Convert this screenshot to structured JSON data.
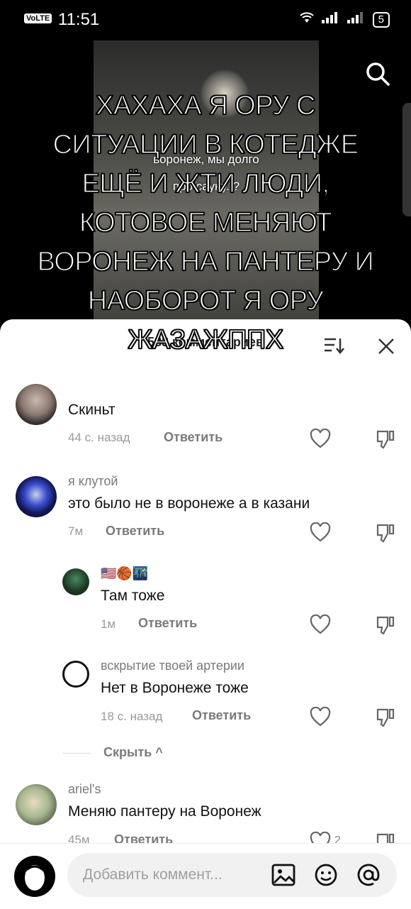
{
  "status_bar": {
    "network": "VoLTE",
    "time": "11:51",
    "battery": "5"
  },
  "video": {
    "caption": "воронеж, мы долго\n...\nпро сауну..?"
  },
  "overlay_text": "ХАХАХА Я ОРУ С СИТУАЦИИ В КОТЕДЖЕ ЕЩЁ И ЖТИ ЛЮДИ, КОТОВОЕ МЕНЯЮТ ВОРОНЕЖ НА ПАНТЕРУ И НАОБОРОТ Я ОРУ ЖАЗАЖППХ",
  "comments_header": {
    "count_label": "583 комментариев"
  },
  "comments": [
    {
      "username": "",
      "text": "Скиньт",
      "time": "44 с. назад",
      "reply_label": "Ответить"
    },
    {
      "username": "я клутой",
      "text": "это было не в воронеже а в казани",
      "time": "7м",
      "reply_label": "Ответить"
    },
    {
      "username": "🇺🇸🏀🌃",
      "text": "Там тоже",
      "time": "1м",
      "reply_label": "Ответить"
    },
    {
      "username": "вскрытие твоей артерии",
      "text": "Нет в Воронеже тоже",
      "time": "18 с. назад",
      "reply_label": "Ответить"
    },
    {
      "username": "ariel's",
      "text": "Меняю пантеру на Воронеж",
      "time": "45м",
      "reply_label": "Ответить",
      "likes": "2"
    }
  ],
  "hide_replies_label": "Скрыть ^",
  "input": {
    "placeholder": "Добавить коммент..."
  },
  "colors": {
    "sheet_bg": "#ffffff",
    "text_primary": "#111111",
    "text_secondary": "#7a7a7a"
  }
}
